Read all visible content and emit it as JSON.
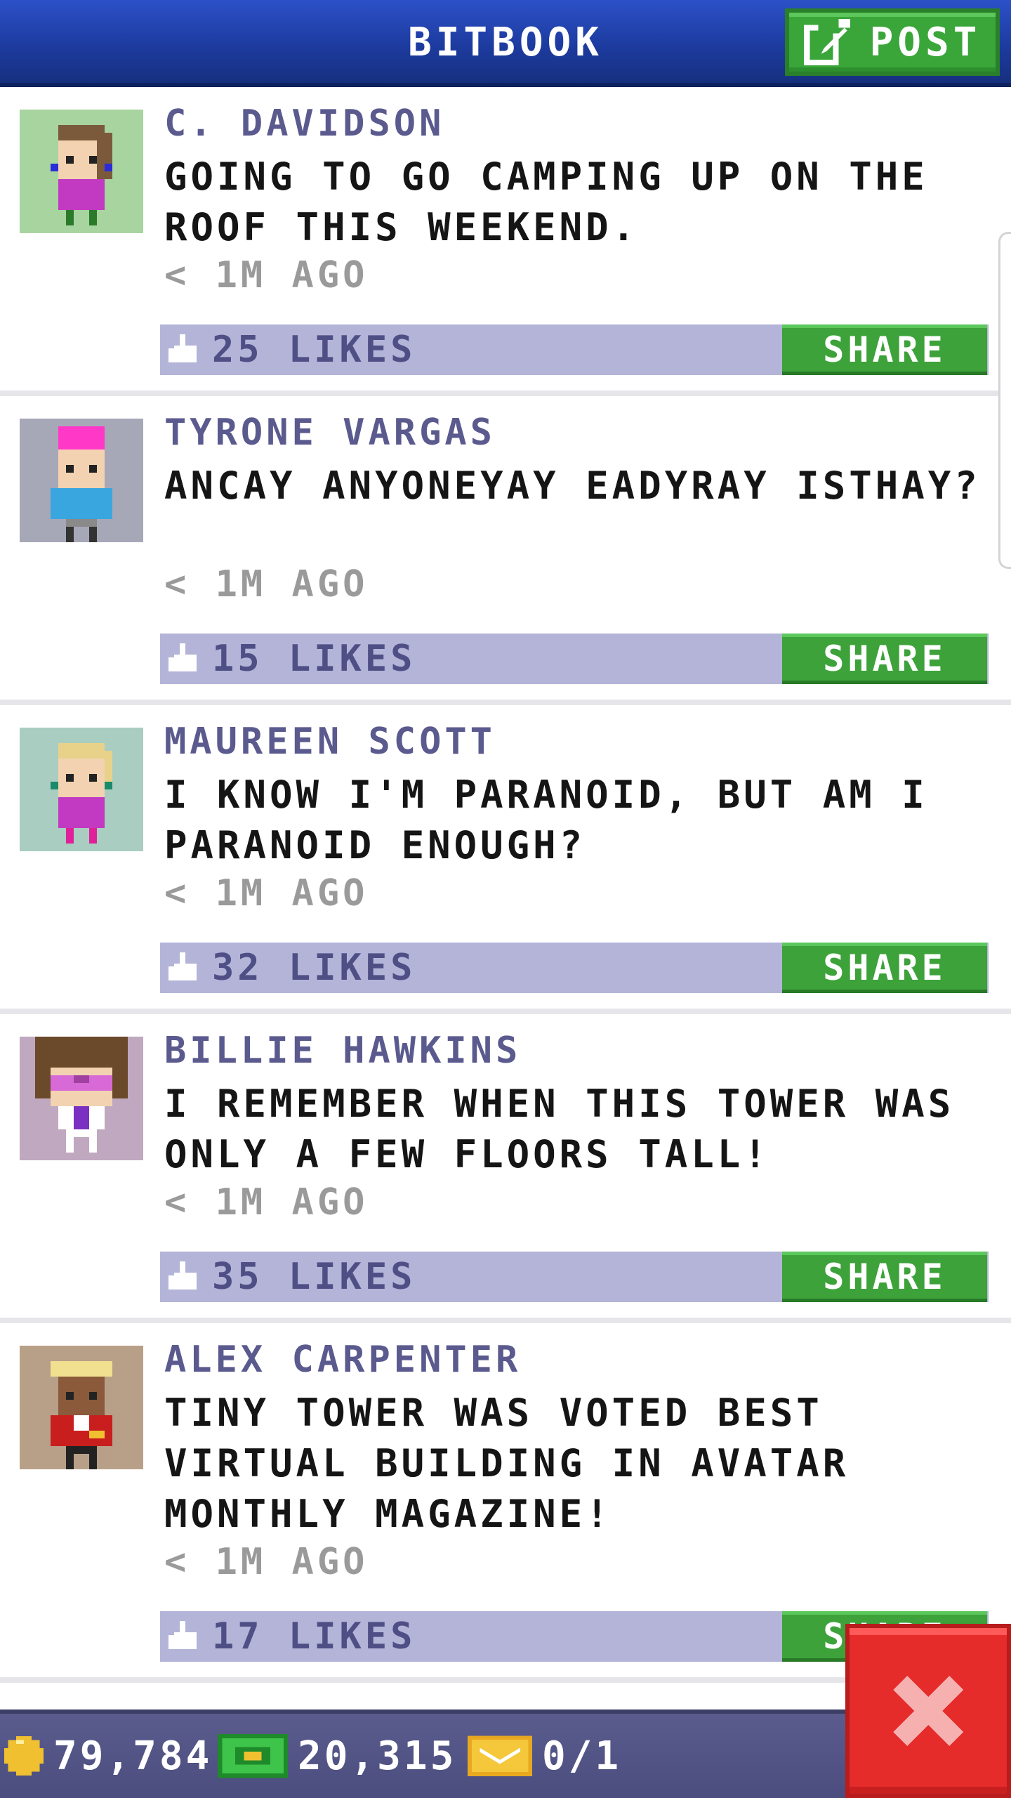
{
  "header": {
    "title": "BITBOOK",
    "post_label": "POST"
  },
  "posts": [
    {
      "author": "C. DAVIDSON",
      "message": "GOING TO GO CAMPING UP ON THE ROOF THIS WEEKEND.",
      "time": "< 1M AGO",
      "likes": "25 LIKES",
      "share_label": "SHARE",
      "avatar_bg": "#a8d4a0"
    },
    {
      "author": "TYRONE VARGAS",
      "message": "ANCAY ANYONEYAY EADYRAY ISTHAY?",
      "time": "< 1M AGO",
      "likes": "15 LIKES",
      "share_label": "SHARE",
      "avatar_bg": "#a6a8b8"
    },
    {
      "author": "MAUREEN SCOTT",
      "message": "I KNOW I'M PARANOID, BUT AM I PARANOID ENOUGH?",
      "time": "< 1M AGO",
      "likes": "32 LIKES",
      "share_label": "SHARE",
      "avatar_bg": "#a9cdc0"
    },
    {
      "author": "BILLIE HAWKINS",
      "message": "I REMEMBER WHEN THIS TOWER WAS ONLY A FEW FLOORS TALL!",
      "time": "< 1M AGO",
      "likes": "35 LIKES",
      "share_label": "SHARE",
      "avatar_bg": "#c0a8c0"
    },
    {
      "author": "ALEX CARPENTER",
      "message": "TINY TOWER WAS VOTED BEST VIRTUAL BUILDING IN AVATAR MONTHLY MAGAZINE!",
      "time": "< 1M AGO",
      "likes": "17 LIKES",
      "share_label": "SHARE",
      "avatar_bg": "#b8a088"
    }
  ],
  "status_bar": {
    "coins": "79,784",
    "bux": "20,315",
    "tickets": "0/1"
  },
  "colors": {
    "header_blue": "#1c3a9c",
    "share_green": "#3da23a",
    "like_bar": "#b3b4d8",
    "author_text": "#5b5a8e",
    "close_red": "#e62b2b"
  },
  "icons": {
    "post": "edit-icon",
    "like": "thumbs-up-icon",
    "coin": "coin-icon",
    "bux": "bux-icon",
    "ticket": "ticket-icon",
    "close": "close-icon"
  }
}
